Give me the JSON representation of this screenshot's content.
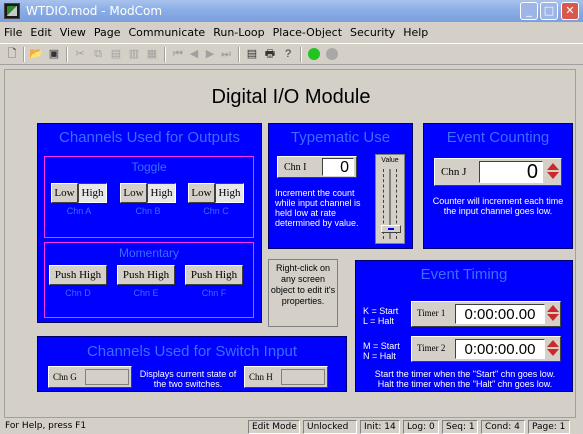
{
  "window": {
    "title": "WTDIO.mod - ModCom",
    "controls": [
      "_",
      "□",
      "✕"
    ]
  },
  "menu": [
    "File",
    "Edit",
    "View",
    "Page",
    "Communicate",
    "Run-Loop",
    "Place-Object",
    "Security",
    "Help"
  ],
  "toolbar": {
    "icons": [
      "new-file",
      "open-folder",
      "save",
      "cut",
      "copy",
      "paste",
      "paste-special",
      "paste-link",
      "first-page",
      "previous-page",
      "next-page",
      "last-page",
      "properties",
      "print",
      "help",
      "run-green",
      "stop-gray"
    ]
  },
  "page": {
    "title": "Digital I/O Module"
  },
  "outputs": {
    "title": "Channels Used for Outputs",
    "toggle": {
      "title": "Toggle",
      "groups": [
        {
          "low": "Low",
          "high": "High",
          "channel": "Chn A"
        },
        {
          "low": "Low",
          "high": "High",
          "channel": "Chn B"
        },
        {
          "low": "Low",
          "high": "High",
          "channel": "Chn C"
        }
      ]
    },
    "momentary": {
      "title": "Momentary",
      "groups": [
        {
          "label": "Push High",
          "channel": "Chn D"
        },
        {
          "label": "Push High",
          "channel": "Chn E"
        },
        {
          "label": "Push High",
          "channel": "Chn F"
        }
      ]
    }
  },
  "typematic": {
    "title": "Typematic Use",
    "channel_label": "Chn I",
    "value": "0",
    "slider_label": "Value",
    "slider_level": 0.1,
    "description": "Increment the count while input channel is held low at rate determined by value."
  },
  "counting": {
    "title": "Event Counting",
    "channel_label": "Chn J",
    "value": "0",
    "description": "Counter will increment each time the input channel goes low."
  },
  "note": {
    "text": "Right-click on any screen object to edit it's properties."
  },
  "timing": {
    "title": "Event Timing",
    "timers": [
      {
        "keys": "K = Start\nL = Halt",
        "label": "Timer 1",
        "value": "0:00:00.00"
      },
      {
        "keys": "M = Start\nN = Halt",
        "label": "Timer 2",
        "value": "0:00:00.00"
      }
    ],
    "description": "Start the timer when the \"Start\" chn goes low.\nHalt the timer when the \"Halt\" chn goes low."
  },
  "switches": {
    "title": "Channels Used for Switch Input",
    "chn_g": "Chn G",
    "chn_h": "Chn H",
    "description": "Displays current state of the two switches."
  },
  "status": {
    "help": "For Help, press F1",
    "mode": "Edit Mode",
    "lock": "Unlocked",
    "init": "Init: 14",
    "log": "Log: 0",
    "seq": "Seq: 1",
    "cond": "Cond: 4",
    "page": "Page: 1"
  },
  "colors": {
    "panel": "#0000ff",
    "panel_title": "#3b6dff",
    "inner_border": "#ff33ff",
    "title_bar": "#8aaee6"
  }
}
